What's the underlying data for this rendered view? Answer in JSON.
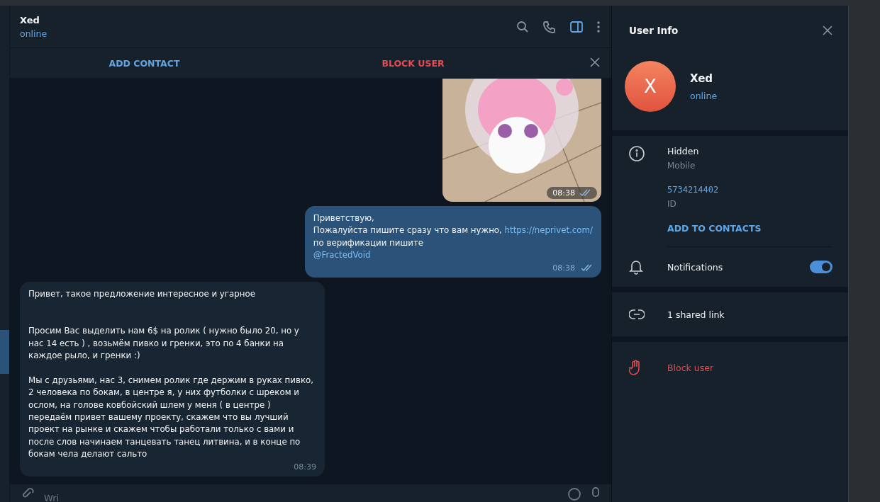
{
  "chat_header": {
    "name": "Xed",
    "status": "online"
  },
  "action_bar": {
    "add_contact": "ADD CONTACT",
    "block_user": "BLOCK USER"
  },
  "messages": [
    {
      "kind": "sticker",
      "outgoing": true,
      "time": "08:38",
      "read": true
    },
    {
      "kind": "text",
      "outgoing": true,
      "text": "Приветствую,\nПожалуйста пишите сразу что вам нужно, ",
      "link": "https://neprivet.com/",
      "text_after": "\nпо верификации пишите\n",
      "mention": "@FractedVoid",
      "time": "08:38",
      "read": true
    },
    {
      "kind": "text",
      "outgoing": false,
      "text": "Привет, такое предложение интересное и угарное\n\n\nПросим Вас выделить нам 6$ на ролик ( нужно было 20, но у нас 14 есть ) , возьмём пивко и гренки, это по 4 банки на каждое рыло, и гренки :)\n\nМы с друзьями, нас 3, снимем ролик где держим в руках пивко, 2 человека по бокам, в центре я, у них футболки с шреком и ослом, на голове ковбойский шлем у меня ( в центре ) передаём привет вашему проекту, скажем что вы лучший проект на рынке и скажем чтобы работали только с вами и после слов начинаем танцевать танец литвина, и в конце по бокам чела делают сальто",
      "time": "08:39"
    }
  ],
  "composer": {
    "placeholder": "Wri"
  },
  "user_info": {
    "title": "User Info",
    "avatar_letter": "X",
    "name": "Xed",
    "status": "online",
    "phone": "Hidden",
    "phone_label": "Mobile",
    "id": "5734214402",
    "id_label": "ID",
    "add_to_contacts": "ADD TO CONTACTS",
    "notifications": {
      "label": "Notifications",
      "on": true
    },
    "shared_links": "1 shared link",
    "block_user": "Block user"
  }
}
